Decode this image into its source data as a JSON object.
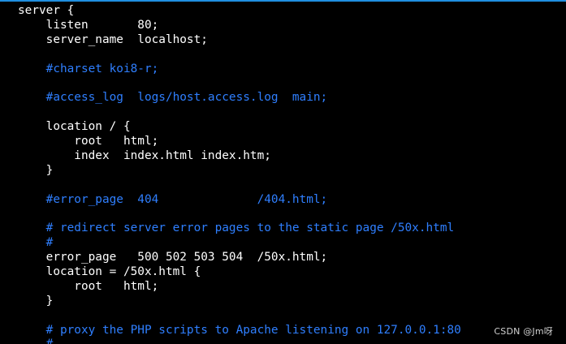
{
  "colors": {
    "background": "#000000",
    "code_text": "#ffffff",
    "comment_text": "#2f7fff",
    "top_border": "#1f8fe0",
    "watermark": "#d0d0d0"
  },
  "editor": {
    "lines": [
      {
        "text": "server {",
        "kind": "code"
      },
      {
        "text": "    listen       80;",
        "kind": "code"
      },
      {
        "text": "    server_name  localhost;",
        "kind": "code"
      },
      {
        "text": "",
        "kind": "code"
      },
      {
        "text": "    #charset koi8-r;",
        "kind": "comment"
      },
      {
        "text": "",
        "kind": "code"
      },
      {
        "text": "    #access_log  logs/host.access.log  main;",
        "kind": "comment"
      },
      {
        "text": "",
        "kind": "code"
      },
      {
        "text": "    location / {",
        "kind": "code"
      },
      {
        "text": "        root   html;",
        "kind": "code"
      },
      {
        "text": "        index  index.html index.htm;",
        "kind": "code"
      },
      {
        "text": "    }",
        "kind": "code"
      },
      {
        "text": "",
        "kind": "code"
      },
      {
        "text": "    #error_page  404              /404.html;",
        "kind": "comment"
      },
      {
        "text": "",
        "kind": "code"
      },
      {
        "text": "    # redirect server error pages to the static page /50x.html",
        "kind": "comment"
      },
      {
        "text": "    #",
        "kind": "comment"
      },
      {
        "text": "    error_page   500 502 503 504  /50x.html;",
        "kind": "code"
      },
      {
        "text": "    location = /50x.html {",
        "kind": "code"
      },
      {
        "text": "        root   html;",
        "kind": "code"
      },
      {
        "text": "    }",
        "kind": "code"
      },
      {
        "text": "",
        "kind": "code"
      },
      {
        "text": "    # proxy the PHP scripts to Apache listening on 127.0.0.1:80",
        "kind": "comment"
      },
      {
        "text": "    #",
        "kind": "comment"
      }
    ]
  },
  "watermark": {
    "text": "CSDN @Jm呀"
  }
}
